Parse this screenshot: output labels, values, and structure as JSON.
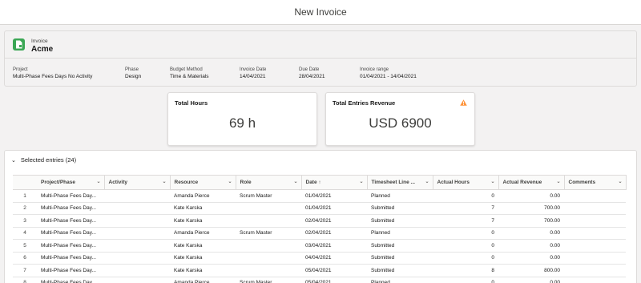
{
  "page": {
    "title": "New Invoice"
  },
  "header": {
    "entity_type": "Invoice",
    "entity_name": "Acme",
    "fields": [
      {
        "label": "Project",
        "value": "Multi-Phase Fees Days No Activity"
      },
      {
        "label": "Phase",
        "value": "Design"
      },
      {
        "label": "Budget Method",
        "value": "Time & Materials"
      },
      {
        "label": "Invoice Date",
        "value": "14/04/2021"
      },
      {
        "label": "Due Date",
        "value": "28/04/2021"
      },
      {
        "label": "Invoice range",
        "value": "01/04/2021 - 14/04/2021"
      }
    ]
  },
  "kpis": {
    "total_hours": {
      "label": "Total Hours",
      "value": "69 h"
    },
    "total_revenue": {
      "label": "Total Entries Revenue",
      "value": "USD 6900",
      "warning_icon": "warning-icon",
      "warning_color": "#fe9339"
    }
  },
  "entries": {
    "section_title": "Selected entries (24)",
    "columns": [
      "Project/Phase",
      "Activity",
      "Resource",
      "Role",
      "Date ↑",
      "Timesheet Line ...",
      "Actual Hours",
      "Actual Revenue",
      "Comments"
    ],
    "rows": [
      [
        "1",
        "Multi-Phase Fees Day...",
        "",
        "Amanda Pierce",
        "Scrum Master",
        "01/04/2021",
        "Planned",
        "0",
        "0.00",
        ""
      ],
      [
        "2",
        "Multi-Phase Fees Day...",
        "",
        "Kate Karska",
        "",
        "01/04/2021",
        "Submitted",
        "7",
        "700.00",
        ""
      ],
      [
        "3",
        "Multi-Phase Fees Day...",
        "",
        "Kate Karska",
        "",
        "02/04/2021",
        "Submitted",
        "7",
        "700.00",
        ""
      ],
      [
        "4",
        "Multi-Phase Fees Day...",
        "",
        "Amanda Pierce",
        "Scrum Master",
        "02/04/2021",
        "Planned",
        "0",
        "0.00",
        ""
      ],
      [
        "5",
        "Multi-Phase Fees Day...",
        "",
        "Kate Karska",
        "",
        "03/04/2021",
        "Submitted",
        "0",
        "0.00",
        ""
      ],
      [
        "6",
        "Multi-Phase Fees Day...",
        "",
        "Kate Karska",
        "",
        "04/04/2021",
        "Submitted",
        "0",
        "0.00",
        ""
      ],
      [
        "7",
        "Multi-Phase Fees Day...",
        "",
        "Kate Karska",
        "",
        "05/04/2021",
        "Submitted",
        "8",
        "800.00",
        ""
      ],
      [
        "8",
        "Multi-Phase Fees Day...",
        "",
        "Amanda Pierce",
        "Scrum Master",
        "05/04/2021",
        "Planned",
        "0",
        "0.00",
        ""
      ]
    ]
  },
  "colors": {
    "brand_icon": "#3ba755",
    "border": "#dddbda"
  }
}
